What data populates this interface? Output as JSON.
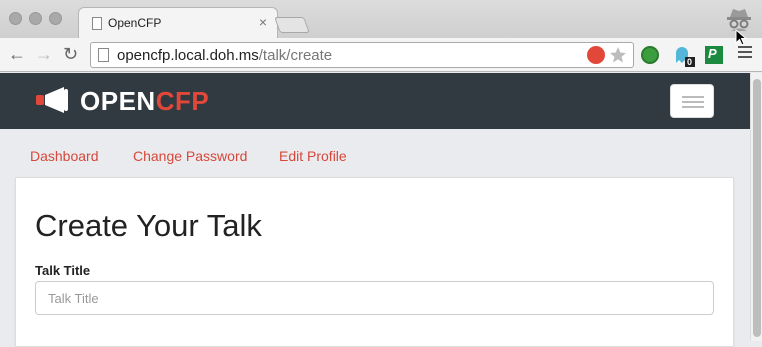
{
  "browser": {
    "tab_title": "OpenCFP",
    "tab_close": "×",
    "url_host": "opencfp.local.doh.ms",
    "url_path": "/talk/create",
    "extension_badge": "0"
  },
  "site": {
    "logo_open": "OPEN",
    "logo_cfp": "CFP",
    "nav": {
      "dashboard": "Dashboard",
      "change_password": "Change Password",
      "edit_profile": "Edit Profile"
    },
    "page_title": "Create Your Talk",
    "form": {
      "title_label": "Talk Title",
      "title_placeholder": "Talk Title"
    }
  },
  "colors": {
    "accent": "#d6483b",
    "header_bg": "#323a41"
  }
}
